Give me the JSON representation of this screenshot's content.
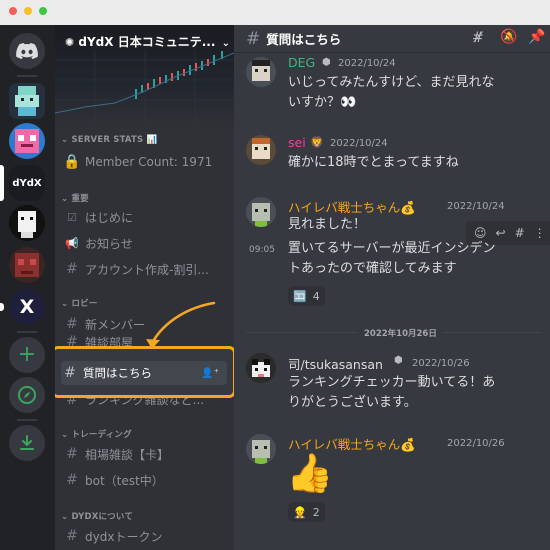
{
  "server": {
    "name": "dYdX 日本コミュニテ...",
    "rail_dydx_label": "dYdX"
  },
  "sidebar": {
    "categories": [
      {
        "id": "server-stats",
        "label": "SERVER STATS 📊"
      },
      {
        "id": "important",
        "label": "重要"
      },
      {
        "id": "lobby",
        "label": "ロビー"
      },
      {
        "id": "trading",
        "label": "トレーディング"
      },
      {
        "id": "about-dydx",
        "label": "DYDXについて"
      }
    ],
    "channels": {
      "member_count": "Member Count: 1971",
      "hajimeni": "はじめに",
      "oshirase": "お知らせ",
      "account": "アカウント作成-割引...",
      "new_member": "新メンバー",
      "chat_hidden": "雑談部屋",
      "question": "質問はこちら",
      "ranking": "ランキング雑談など...",
      "market": "相場雑談【卡】",
      "bot": "bot（test中）",
      "token": "dydxトークン"
    }
  },
  "chat": {
    "channel_name": "質問はこちら",
    "date_divider": "2022年10月26日",
    "messages": [
      {
        "user": "DEG",
        "color": "#43b581",
        "time": "2022/10/24",
        "lines": [
          "いじってみたんすけど、まだ見れな",
          "いすか？👀"
        ]
      },
      {
        "user": "sei",
        "color": "#eb459e",
        "time": "2022/10/24",
        "lines": [
          "確かに18時でとまってますね"
        ]
      },
      {
        "user": "ハイレバ戦士ちゃん💰",
        "color": "#faa61a",
        "time": "2022/10/24",
        "lines": [
          "見れました！"
        ]
      },
      {
        "user": "",
        "color": "",
        "time": "09:05",
        "lines": [
          "置いてるサーバーが最近インシデン",
          "トあったので確認してみます"
        ]
      },
      {
        "user": "司/tsukasansan",
        "color": "#dcddde",
        "time": "2022/10/26",
        "lines": [
          "ランキングチェッカー動いてる！あ",
          "りがとうございます。"
        ]
      },
      {
        "user": "ハイレバ戦士ちゃん💰",
        "color": "#faa61a",
        "time": "2022/10/26",
        "lines": [
          "👍"
        ]
      }
    ],
    "reactions": {
      "r1_emoji": "🈁",
      "r1_count": "4",
      "r2_emoji": "👷",
      "r2_count": "2"
    }
  },
  "colors": {
    "highlight": "#f5a623",
    "rail": "#202225",
    "sidebar": "#2f3136",
    "chat": "#36393f"
  }
}
